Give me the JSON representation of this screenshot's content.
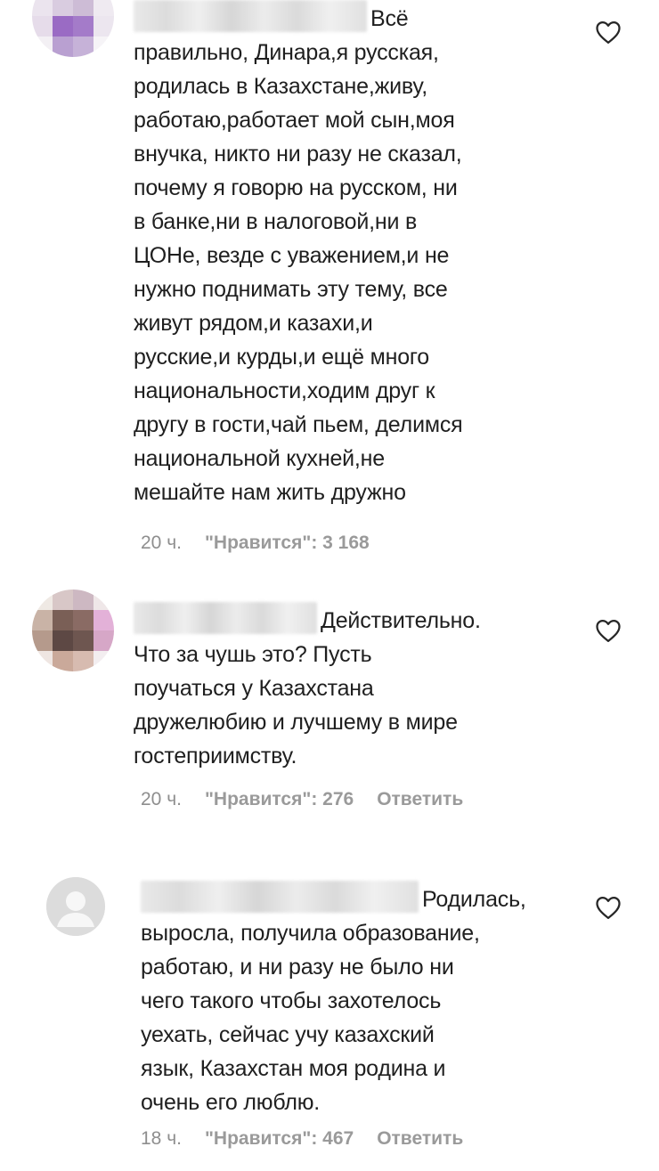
{
  "comments": [
    {
      "first_word": "Всё",
      "lines": [
        "правильно, Динара,я русская,",
        "родилась в Казахстане,живу,",
        "работаю,работает мой сын,моя",
        "внучка, никто ни разу не сказал,",
        "почему я говорю на русском, ни",
        "в банке,ни в налоговой,ни в",
        "ЦОНе, везде с уважением,и не",
        "нужно поднимать эту тему, все",
        "живут рядом,и казахи,и",
        "русские,и курды,и ещё много",
        "национальности,ходим друг к",
        "другу в гости,чай пьем, делимся",
        "национальной кухней,не",
        "мешайте нам жить дружно"
      ],
      "time": "20 ч.",
      "likes": "\"Нравится\": 3 168",
      "reply": ""
    },
    {
      "first_word": "Действительно.",
      "lines": [
        "Что за чушь это? Пусть",
        "поучаться у Казахстана",
        "дружелюбию и лучшему в мире",
        "гостеприимству."
      ],
      "time": "20 ч.",
      "likes": "\"Нравится\": 276",
      "reply": "Ответить"
    },
    {
      "first_word": "Родилась,",
      "lines": [
        "выросла, получила образование,",
        "работаю, и ни разу не было ни",
        "чего такого чтобы захотелось",
        "уехать, сейчас учу казахский",
        "язык, Казахстан моя родина и",
        "очень его люблю."
      ],
      "time": "18 ч.",
      "likes": "\"Нравится\": 467",
      "reply": "Ответить"
    }
  ],
  "icons": {
    "heart": "heart-icon",
    "default_avatar": "user-silhouette-icon"
  },
  "colors": {
    "text": "#1f1f1f",
    "meta": "#8e8e8e",
    "avatar1_accent": "#9a6bc4",
    "avatar2_accent": "#e3b1d8"
  }
}
